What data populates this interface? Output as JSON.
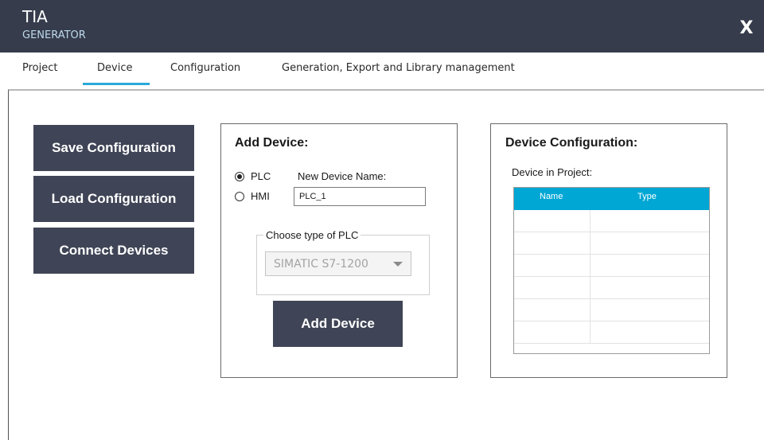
{
  "app": {
    "logo_main": "TIA",
    "logo_sub": "GENERATOR",
    "close_label": "X"
  },
  "tabs": [
    {
      "label": "Project"
    },
    {
      "label": "Device",
      "active": true
    },
    {
      "label": "Configuration"
    },
    {
      "label": "Generation, Export and Library management"
    }
  ],
  "side_buttons": {
    "save": "Save Configuration",
    "load": "Load Configuration",
    "connect": "Connect Devices"
  },
  "add_device": {
    "title": "Add Device:",
    "radio_plc": "PLC",
    "radio_hmi": "HMI",
    "selected": "PLC",
    "name_label": "New Device Name:",
    "name_value": "PLC_1",
    "group_label": "Choose type of PLC",
    "plc_type": "SIMATIC S7-1200",
    "button": "Add Device"
  },
  "device_config": {
    "title": "Device Configuration:",
    "subtitle": "Device in Project:",
    "columns": [
      "Name",
      "Type"
    ],
    "rows": [
      [
        "",
        ""
      ],
      [
        "",
        ""
      ],
      [
        "",
        ""
      ],
      [
        "",
        ""
      ],
      [
        "",
        ""
      ],
      [
        "",
        ""
      ]
    ]
  },
  "colors": {
    "titlebar": "#363c4c",
    "button": "#3f4456",
    "accent": "#2aa9d8",
    "grid_header": "#00a7d4"
  }
}
